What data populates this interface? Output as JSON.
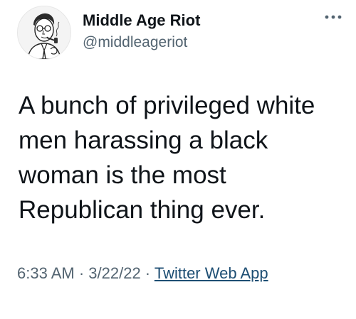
{
  "tweet": {
    "author": {
      "display_name": "Middle Age Riot",
      "handle": "@middleageriot",
      "avatar_icon": "vintage-man-with-pipe-illustration"
    },
    "more_icon": "more-options-dots-icon",
    "text": "A bunch of privileged white men harassing a black woman is the most Republican thing ever.",
    "timestamp": {
      "time": "6:33 AM",
      "separator": " · ",
      "date": "3/22/22",
      "separator2": " · ",
      "source": "Twitter Web App"
    }
  },
  "colors": {
    "text": "#0f1419",
    "secondary": "#536471",
    "link": "#1d4e73"
  }
}
